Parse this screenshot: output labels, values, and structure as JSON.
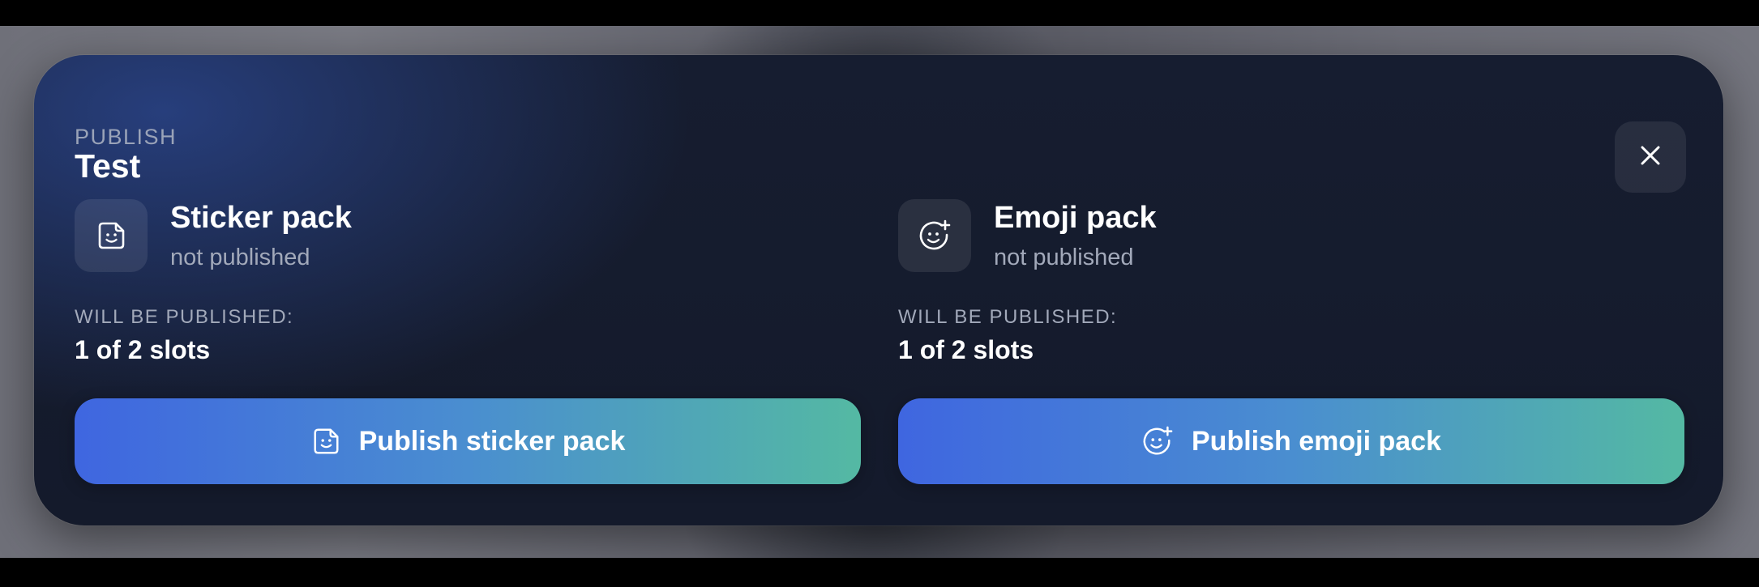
{
  "header": {
    "eyebrow": "PUBLISH",
    "title": "Test"
  },
  "close_button": {
    "icon": "close-icon"
  },
  "packs": [
    {
      "icon": "sticker-icon",
      "name": "Sticker pack",
      "status": "not published",
      "will_label": "WILL BE PUBLISHED:",
      "slots": "1 of 2 slots",
      "button_label": "Publish sticker pack"
    },
    {
      "icon": "emoji-add-icon",
      "name": "Emoji pack",
      "status": "not published",
      "will_label": "WILL BE PUBLISHED:",
      "slots": "1 of 2 slots",
      "button_label": "Publish emoji pack"
    }
  ],
  "colors": {
    "modal_background": "#151b2c",
    "button_gradient_start": "#3f66e0",
    "button_gradient_end": "#54b9a3",
    "muted_text": "#a2a9ba"
  }
}
